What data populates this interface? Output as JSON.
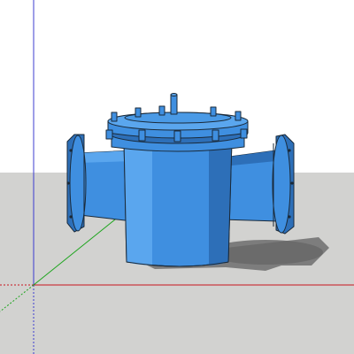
{
  "viewport": {
    "sky_color": "#ffffff",
    "ground_color": "#d2d2d0",
    "axis_colors": {
      "red": "#c8141e",
      "green": "#1fa51f",
      "blue": "#3c3cd0"
    }
  },
  "model": {
    "object": "basket-strainer",
    "body_color": "#3f8fe0",
    "body_light": "#5aa6ee",
    "body_dark": "#2d6fb8",
    "outline_color": "#1a2a3a",
    "shadow_color": "#6e6e6e"
  }
}
